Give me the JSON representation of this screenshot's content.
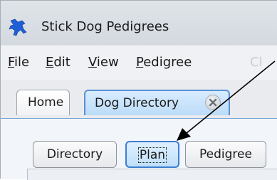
{
  "window": {
    "title": "Stick Dog Pedigrees",
    "app_icon": "blue-stick-dog-icon"
  },
  "menu": {
    "items": [
      {
        "label_underlined": "F",
        "label_rest": "ile"
      },
      {
        "label_underlined": "E",
        "label_rest": "dit"
      },
      {
        "label_underlined": "V",
        "label_rest": "iew"
      },
      {
        "label_underlined": "P",
        "label_rest": "edigree"
      }
    ],
    "cut_off_label": "Cl"
  },
  "tabs": [
    {
      "label": "Home"
    },
    {
      "label": "Dog Directory",
      "active": true,
      "closable": true,
      "close_icon": "close-x-icon"
    }
  ],
  "sub_buttons": [
    {
      "label": "Directory"
    },
    {
      "label": "Plan",
      "selected": true
    },
    {
      "label": "Pedigree"
    }
  ],
  "colors": {
    "active_tab": "#c6e2fb",
    "active_border": "#3d7fd0",
    "annotation_arrow": "#000000"
  }
}
